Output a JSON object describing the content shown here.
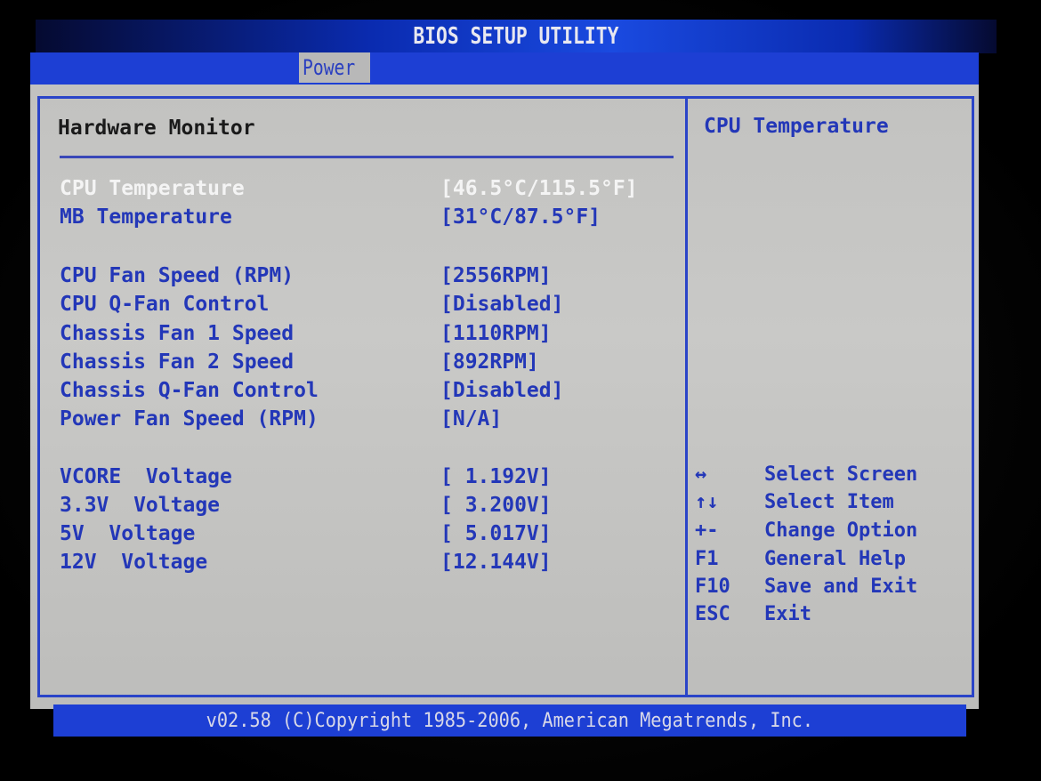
{
  "app": {
    "title": "BIOS SETUP UTILITY"
  },
  "menu": {
    "active_tab": "Power"
  },
  "main": {
    "section_title": "Hardware Monitor",
    "items": [
      {
        "label": "CPU Temperature",
        "value": "[46.5°C/115.5°F]",
        "selected": true
      },
      {
        "label": "MB Temperature",
        "value": "[31°C/87.5°F]",
        "selected": false
      },
      {
        "label": "CPU Fan Speed (RPM)",
        "value": "[2556RPM]",
        "selected": false
      },
      {
        "label": "CPU Q-Fan Control",
        "value": "[Disabled]",
        "selected": false
      },
      {
        "label": "Chassis Fan 1 Speed",
        "value": "[1110RPM]",
        "selected": false
      },
      {
        "label": "Chassis Fan 2 Speed",
        "value": "[892RPM]",
        "selected": false
      },
      {
        "label": "Chassis Q-Fan Control",
        "value": "[Disabled]",
        "selected": false
      },
      {
        "label": "Power Fan Speed (RPM)",
        "value": "[N/A]",
        "selected": false
      },
      {
        "label": "VCORE  Voltage",
        "value": "[ 1.192V]",
        "selected": false
      },
      {
        "label": "3.3V  Voltage",
        "value": "[ 3.200V]",
        "selected": false
      },
      {
        "label": "5V  Voltage",
        "value": "[ 5.017V]",
        "selected": false
      },
      {
        "label": "12V  Voltage",
        "value": "[12.144V]",
        "selected": false
      }
    ]
  },
  "help": {
    "title": "CPU Temperature",
    "keys": [
      {
        "key": "↔",
        "desc": "Select Screen"
      },
      {
        "key": "↑↓",
        "desc": "Select Item"
      },
      {
        "key": "+-",
        "desc": "Change Option"
      },
      {
        "key": "F1",
        "desc": "General Help"
      },
      {
        "key": "F10",
        "desc": "Save and Exit"
      },
      {
        "key": "ESC",
        "desc": "Exit"
      }
    ]
  },
  "footer": {
    "text": "v02.58 (C)Copyright 1985-2006, American Megatrends, Inc."
  },
  "colors": {
    "accent_blue": "#1d3fd4",
    "text_blue": "#2337b8",
    "panel_gray": "#c4c4c2",
    "selected_text": "#f4f4f4"
  }
}
